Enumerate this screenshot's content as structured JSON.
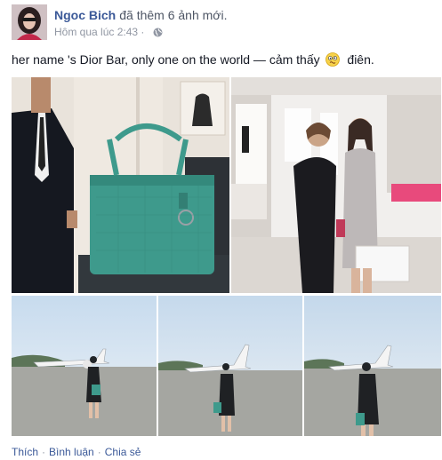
{
  "post": {
    "author": "Ngoc Bich",
    "action_text": "đã thêm 6 ảnh mới.",
    "timestamp": "Hôm qua lúc 2:43",
    "timestamp_separator": "·",
    "privacy_icon": "globe-icon",
    "status_before": "her name 's Dior Bar, only one on the world — cảm thấy",
    "feeling_icon": "confused-face-icon",
    "status_after": "điên.",
    "photo_count": 5
  },
  "actions": {
    "like": "Thích",
    "comment": "Bình luận",
    "share": "Chia sẻ",
    "separator": "·"
  },
  "colors": {
    "link": "#3b5998",
    "meta": "#9197a3",
    "text": "#141823",
    "bag_teal": "#3e9a8c"
  }
}
